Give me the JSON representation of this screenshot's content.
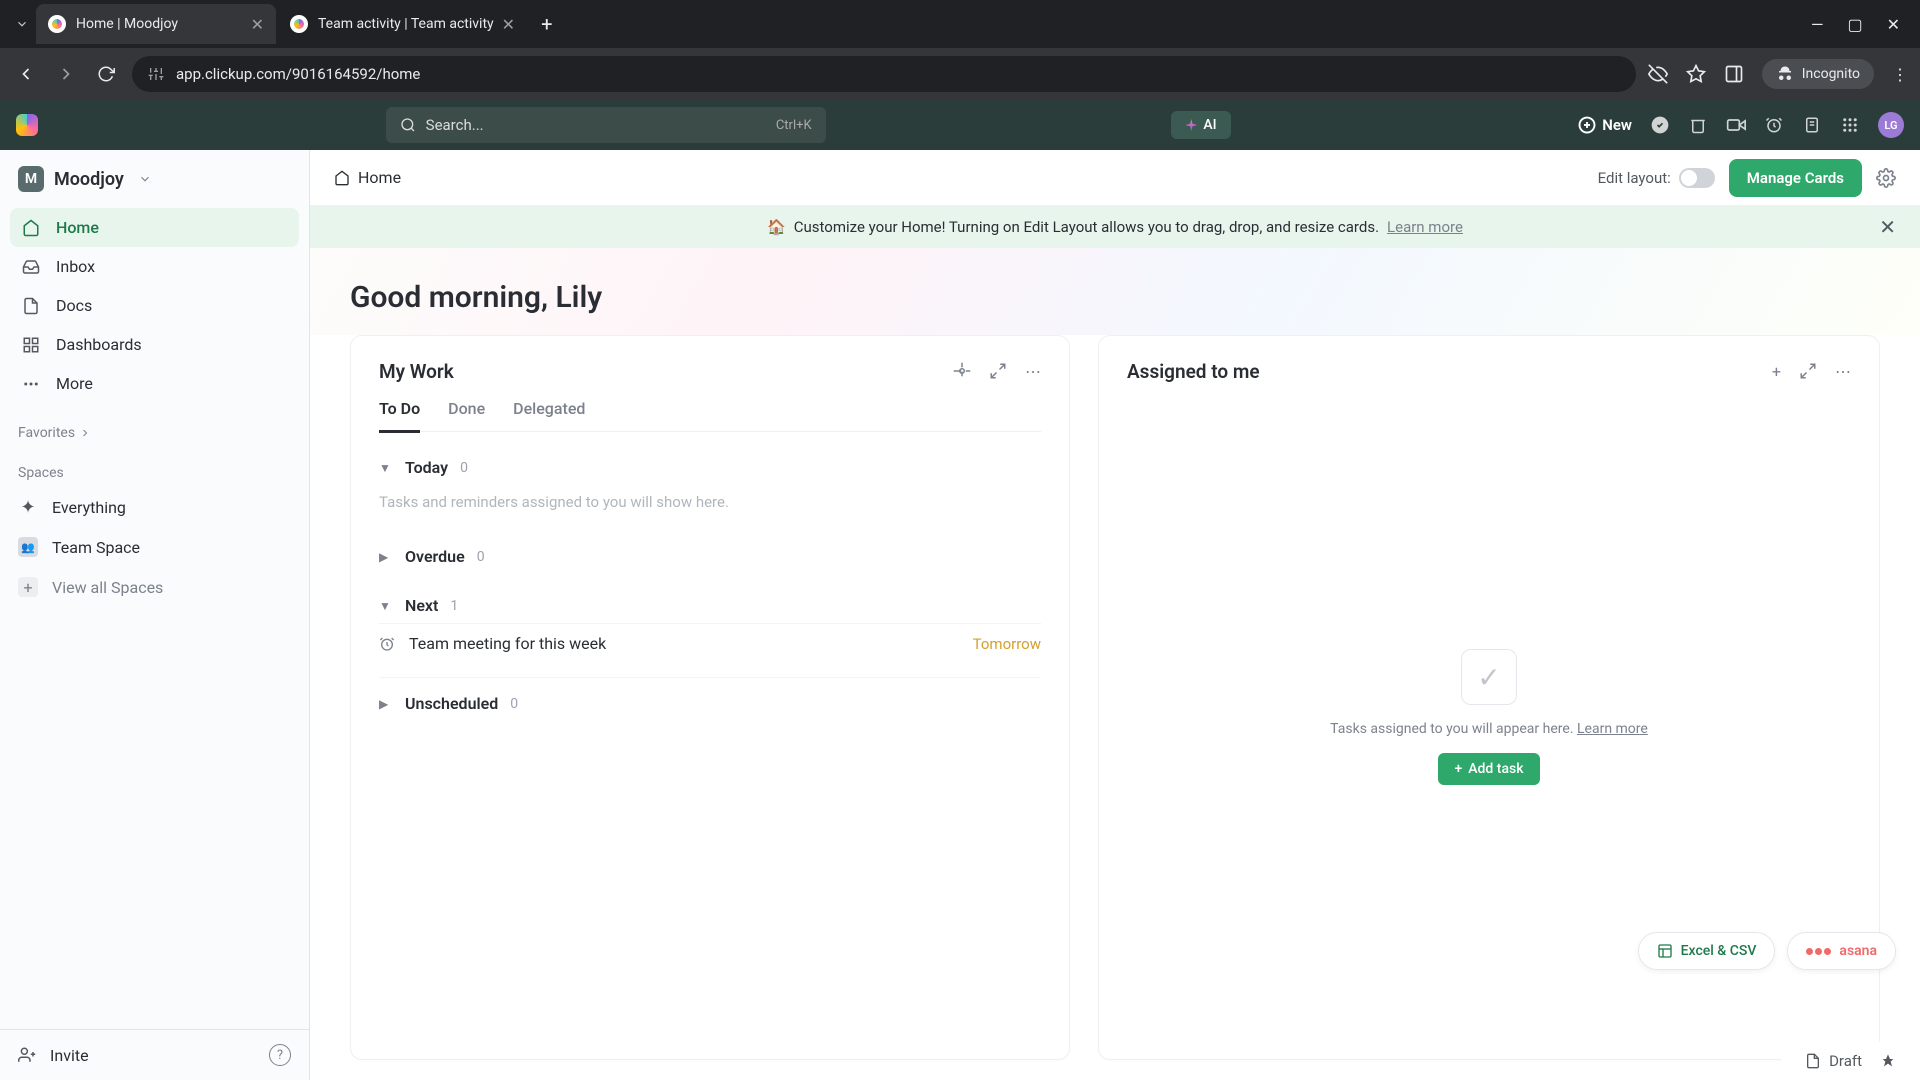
{
  "browser": {
    "tabs": [
      {
        "title": "Home | Moodjoy",
        "active": true
      },
      {
        "title": "Team activity | Team activity",
        "active": false
      }
    ],
    "url": "app.clickup.com/9016164592/home",
    "incognito": "Incognito"
  },
  "header": {
    "search_placeholder": "Search...",
    "search_kbd": "Ctrl+K",
    "ai_label": "AI",
    "new_label": "New",
    "avatar_initials": "LG"
  },
  "sidebar": {
    "workspace": {
      "badge": "M",
      "name": "Moodjoy"
    },
    "nav": [
      {
        "label": "Home",
        "active": true
      },
      {
        "label": "Inbox",
        "active": false
      },
      {
        "label": "Docs",
        "active": false
      },
      {
        "label": "Dashboards",
        "active": false
      },
      {
        "label": "More",
        "active": false
      }
    ],
    "favorites_label": "Favorites",
    "spaces_label": "Spaces",
    "spaces": {
      "everything": "Everything",
      "team_space": "Team Space",
      "view_all": "View all Spaces"
    },
    "invite": "Invite"
  },
  "topbar": {
    "breadcrumb": "Home",
    "edit_layout": "Edit layout:",
    "manage_cards": "Manage Cards"
  },
  "banner": {
    "text": "Customize your Home! Turning on Edit Layout allows you to drag, drop, and resize cards.",
    "link": "Learn more"
  },
  "greeting": "Good morning, Lily",
  "my_work": {
    "title": "My Work",
    "tabs": [
      "To Do",
      "Done",
      "Delegated"
    ],
    "active_tab": 0,
    "groups": {
      "today": {
        "label": "Today",
        "count": "0",
        "empty": "Tasks and reminders assigned to you will show here.",
        "open": true
      },
      "overdue": {
        "label": "Overdue",
        "count": "0",
        "open": false
      },
      "next": {
        "label": "Next",
        "count": "1",
        "open": true,
        "task": {
          "name": "Team meeting for this week",
          "due": "Tomorrow"
        }
      },
      "unscheduled": {
        "label": "Unscheduled",
        "count": "0",
        "open": false
      }
    }
  },
  "assigned": {
    "title": "Assigned to me",
    "empty_text": "Tasks assigned to you will appear here.",
    "empty_link": "Learn more",
    "add_task": "Add task"
  },
  "chips": {
    "excel": "Excel & CSV",
    "asana": "asana"
  },
  "bottombar": {
    "draft": "Draft"
  }
}
